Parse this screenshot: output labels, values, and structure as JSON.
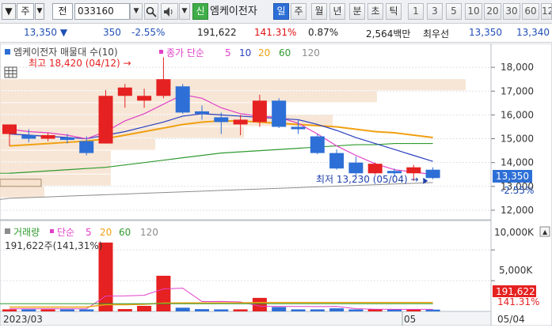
{
  "toolbar": {
    "menu_label": "주",
    "prev_label": "전",
    "code_value": "033160",
    "new_badge": "신",
    "stock_name": "엠케이전자",
    "periods": [
      "일",
      "주",
      "월",
      "년",
      "분",
      "초",
      "틱"
    ],
    "active_period": "일",
    "counts": [
      "1",
      "3",
      "5",
      "10",
      "20",
      "30",
      "60",
      "12"
    ],
    "icons": [
      "dropdown-arrow-icon",
      "search-icon",
      "speaker-icon",
      "dropdown-arrow-icon"
    ]
  },
  "info": {
    "price": "13,350",
    "direction": "▼",
    "change": "350",
    "change_pct": "-2.55%",
    "volume": "191,622",
    "volume_ratio": "141.31%",
    "turnover_rate": "0.87%",
    "amount": "2,564백만",
    "bid_label": "최우선",
    "bid": "13,350",
    "ask": "13,340"
  },
  "price_panel": {
    "title": "엠케이전자 매물대 수(10)",
    "ma_label": "종가 단순",
    "ma_periods": [
      "5",
      "10",
      "20",
      "60",
      "120"
    ],
    "high_annot": "최고 18,420 (04/12) →",
    "low_annot": "최저 13,230 (05/04) →",
    "last_price_tag": "13,350",
    "last_pct_tag": "-2.55%",
    "y_ticks": [
      "18,000",
      "17,000",
      "16,000",
      "15,000",
      "14,000",
      "13,000",
      "12,000"
    ]
  },
  "volume_panel": {
    "label": "거래량",
    "ma_label": "단순",
    "ma_periods": [
      "5",
      "20",
      "60",
      "120"
    ],
    "current": "191,622주(141,31%)",
    "y_ticks": [
      "10,000K",
      "5,000K"
    ],
    "last_tag": "191,622",
    "last_pct_tag": "141.31%"
  },
  "x_axis": [
    "2023/03",
    "05",
    "05/04"
  ],
  "colors": {
    "up": "#e52121",
    "down": "#2d6fd6",
    "ma5": "#e040c8",
    "ma10": "#2a3fbf",
    "ma20": "#f0a012",
    "ma60": "#2f9a2f",
    "ma120": "#8c8c8c"
  },
  "chart_data": {
    "type": "candlestick",
    "y_range": [
      11600,
      19000
    ],
    "candles": [
      {
        "o": 15200,
        "h": 15600,
        "l": 14700,
        "c": 15600
      },
      {
        "o": 15150,
        "h": 15400,
        "l": 14850,
        "c": 15000
      },
      {
        "o": 15000,
        "h": 15250,
        "l": 14900,
        "c": 15150
      },
      {
        "o": 15050,
        "h": 15200,
        "l": 14800,
        "c": 14950
      },
      {
        "o": 14900,
        "h": 15100,
        "l": 14300,
        "c": 14400
      },
      {
        "o": 14800,
        "h": 17050,
        "l": 14800,
        "c": 16800
      },
      {
        "o": 16800,
        "h": 17300,
        "l": 16300,
        "c": 17150
      },
      {
        "o": 16600,
        "h": 17100,
        "l": 16300,
        "c": 16800
      },
      {
        "o": 16800,
        "h": 18420,
        "l": 16700,
        "c": 17500
      },
      {
        "o": 17200,
        "h": 17300,
        "l": 16050,
        "c": 16100
      },
      {
        "o": 16150,
        "h": 16400,
        "l": 15800,
        "c": 16050
      },
      {
        "o": 15900,
        "h": 16100,
        "l": 15200,
        "c": 15700
      },
      {
        "o": 15600,
        "h": 16000,
        "l": 15150,
        "c": 15800
      },
      {
        "o": 15700,
        "h": 16850,
        "l": 15500,
        "c": 16600
      },
      {
        "o": 16600,
        "h": 16700,
        "l": 15450,
        "c": 15500
      },
      {
        "o": 15500,
        "h": 15800,
        "l": 15200,
        "c": 15400
      },
      {
        "o": 15100,
        "h": 15200,
        "l": 14350,
        "c": 14400
      },
      {
        "o": 14400,
        "h": 14550,
        "l": 13700,
        "c": 13750
      },
      {
        "o": 14000,
        "h": 14250,
        "l": 13400,
        "c": 13550
      },
      {
        "o": 13550,
        "h": 14000,
        "l": 13500,
        "c": 13950
      },
      {
        "o": 13650,
        "h": 13750,
        "l": 13400,
        "c": 13550
      },
      {
        "o": 13550,
        "h": 13900,
        "l": 13230,
        "c": 13800
      },
      {
        "o": 13700,
        "h": 13800,
        "l": 13300,
        "c": 13350
      }
    ],
    "ma5": [
      15400,
      15300,
      15250,
      15150,
      15000,
      15300,
      15750,
      16050,
      16450,
      16850,
      16700,
      16300,
      16050,
      15950,
      15900,
      15650,
      15200,
      14700,
      14300,
      13950,
      13700,
      13600,
      13500
    ],
    "ma10": [
      15200,
      15150,
      15100,
      15050,
      15000,
      15150,
      15300,
      15500,
      15700,
      15950,
      16050,
      16000,
      15950,
      15900,
      15850,
      15800,
      15600,
      15350,
      15050,
      14800,
      14550,
      14300,
      14050
    ],
    "ma20": [
      14700,
      14750,
      14800,
      14850,
      14900,
      15000,
      15150,
      15300,
      15450,
      15600,
      15700,
      15750,
      15750,
      15700,
      15650,
      15600,
      15550,
      15500,
      15400,
      15300,
      15250,
      15150,
      15050
    ],
    "ma60": [
      13550,
      13600,
      13650,
      13700,
      13750,
      13800,
      13900,
      14000,
      14100,
      14200,
      14300,
      14400,
      14450,
      14500,
      14550,
      14600,
      14650,
      14700,
      14750,
      14750,
      14800,
      14800,
      14800
    ],
    "ma120": [
      12500,
      12530,
      12560,
      12590,
      12620,
      12650,
      12680,
      12710,
      12740,
      12770,
      12800,
      12830,
      12860,
      12890,
      12920,
      12950,
      12980,
      13010,
      13040,
      13070,
      13100,
      13130,
      13160
    ],
    "profile": [
      {
        "price": 17250,
        "len": 0.42
      },
      {
        "price": 16750,
        "len": 0.34
      },
      {
        "price": 16250,
        "len": 0.24
      },
      {
        "price": 15750,
        "len": 0.3
      },
      {
        "price": 15250,
        "len": 0.22
      },
      {
        "price": 14750,
        "len": 0.14
      },
      {
        "price": 14250,
        "len": 0.1
      },
      {
        "price": 13750,
        "len": 0.1
      },
      {
        "price": 13250,
        "len": 0.1
      },
      {
        "price": 12750,
        "len": 0.04
      }
    ],
    "volume": [
      330,
      330,
      330,
      330,
      330,
      11200,
      380,
      900,
      5800,
      600,
      370,
      330,
      330,
      2200,
      700,
      330,
      330,
      500,
      320,
      330,
      320,
      310,
      290
    ],
    "vol_ma5": [
      420,
      420,
      420,
      420,
      420,
      2500,
      2520,
      2620,
      3660,
      3780,
      1610,
      1620,
      1550,
      850,
      800,
      800,
      780,
      800,
      440,
      360,
      330,
      330,
      330
    ],
    "vol_ma20": [
      700,
      700,
      700,
      700,
      700,
      1100,
      1100,
      1150,
      1350,
      1380,
      1380,
      1400,
      1400,
      1450,
      1450,
      1450,
      1450,
      1450,
      1450,
      1450,
      1450,
      1450,
      1450
    ],
    "vol_range": [
      0,
      13500
    ]
  }
}
